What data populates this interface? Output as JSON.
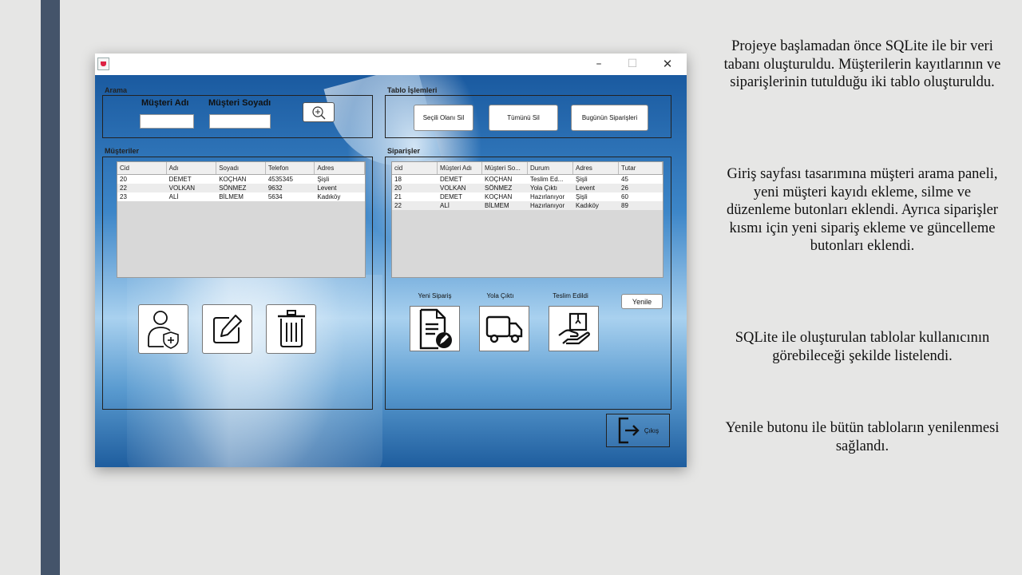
{
  "window": {
    "controls": {
      "minimize": "–",
      "maximize": "☐",
      "close": "✕"
    }
  },
  "search": {
    "group_label": "Arama",
    "first_name_label": "Müşteri Adı",
    "last_name_label": "Müşteri Soyadı",
    "first_name_value": "",
    "last_name_value": ""
  },
  "table_ops": {
    "group_label": "Tablo İşlemleri",
    "delete_selected": "Seçili Olanı Sil",
    "delete_all": "Tümünü Sil",
    "todays_orders": "Bugünün Siparişleri"
  },
  "customers": {
    "group_label": "Müşteriler",
    "columns": [
      "Cid",
      "Adı",
      "Soyadı",
      "Telefon",
      "Adres"
    ],
    "rows": [
      [
        "20",
        "DEMET",
        "KOÇHAN",
        "4535345",
        "Şişli"
      ],
      [
        "22",
        "VOLKAN",
        "SÖNMEZ",
        "9632",
        "Levent"
      ],
      [
        "23",
        "ALİ",
        "BİLMEM",
        "5634",
        "Kadıköy"
      ]
    ]
  },
  "orders": {
    "group_label": "Siparişler",
    "columns": [
      "cid",
      "Müşteri Adı",
      "Müşteri So...",
      "Durum",
      "Adres",
      "Tutar"
    ],
    "rows": [
      [
        "18",
        "DEMET",
        "KOÇHAN",
        "Teslim Ed...",
        "Şişli",
        "45"
      ],
      [
        "20",
        "VOLKAN",
        "SÖNMEZ",
        "Yola Çıktı",
        "Levent",
        "26"
      ],
      [
        "21",
        "DEMET",
        "KOÇHAN",
        "Hazırlanıyor",
        "Şişli",
        "60"
      ],
      [
        "22",
        "ALİ",
        "BİLMEM",
        "Hazırlanıyor",
        "Kadıköy",
        "89"
      ]
    ],
    "new_order_label": "Yeni Sipariş",
    "shipped_label": "Yola Çıktı",
    "delivered_label": "Teslim Edildi",
    "refresh": "Yenile"
  },
  "exit": {
    "label": "Çıkış"
  },
  "notes": [
    "Projeye başlamadan önce SQLite ile bir veri tabanı oluşturuldu. Müşterilerin kayıtlarının ve siparişlerinin tutulduğu iki tablo oluşturuldu.",
    "Giriş sayfası tasarımına müşteri arama paneli, yeni müşteri kayıdı ekleme, silme ve düzenleme butonları eklendi. Ayrıca siparişler kısmı için yeni sipariş ekleme ve güncelleme butonları eklendi.",
    "SQLite ile oluşturulan tablolar kullanıcının görebileceği şekilde listelendi.",
    "Yenile butonu ile bütün tabloların yenilenmesi sağlandı."
  ],
  "colors": {
    "sidebar": "#44546a",
    "slide_background": "#e6e6e5"
  }
}
